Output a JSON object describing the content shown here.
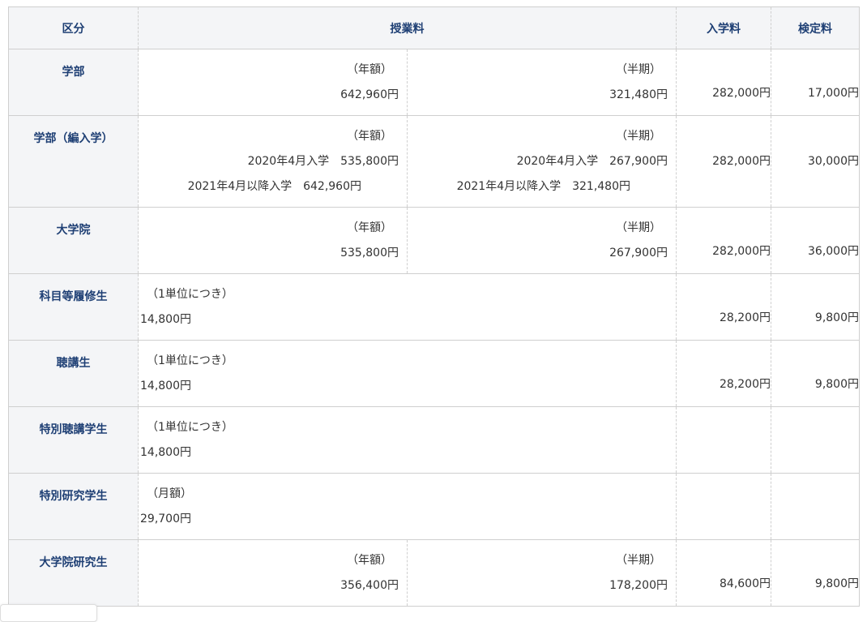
{
  "header": {
    "category": "区分",
    "tuition": "授業料",
    "admission": "入学料",
    "exam": "検定料"
  },
  "rows": [
    {
      "category": "学部",
      "annual_label": "（年額）",
      "annual": "642,960円",
      "half_label": "（半期）",
      "half": "321,480円",
      "admission": "282,000円",
      "exam": "17,000円"
    },
    {
      "category": "学部（編入学）",
      "annual_label": "（年額）",
      "annual_2020": "2020年4月入学　535,800円",
      "annual_2021": "2021年4月以降入学　642,960円",
      "half_label": "（半期）",
      "half_2020": "2020年4月入学　267,900円",
      "half_2021": "2021年4月以降入学　321,480円",
      "admission": "282,000円",
      "exam": "30,000円"
    },
    {
      "category": "大学院",
      "annual_label": "（年額）",
      "annual": "535,800円",
      "half_label": "（半期）",
      "half": "267,900円",
      "admission": "282,000円",
      "exam": "36,000円"
    },
    {
      "category": "科目等履修生",
      "unit_label": "（1単位につき）",
      "unit": "14,800円",
      "admission": "28,200円",
      "exam": "9,800円"
    },
    {
      "category": "聴講生",
      "unit_label": "（1単位につき）",
      "unit": "14,800円",
      "admission": "28,200円",
      "exam": "9,800円"
    },
    {
      "category": "特別聴講学生",
      "unit_label": "（1単位につき）",
      "unit": "14,800円",
      "admission": "",
      "exam": ""
    },
    {
      "category": "特別研究学生",
      "unit_label": "（月額）",
      "unit": "29,700円",
      "admission": "",
      "exam": ""
    },
    {
      "category": "大学院研究生",
      "annual_label": "（年額）",
      "annual": "356,400円",
      "half_label": "（半期）",
      "half": "178,200円",
      "admission": "84,600円",
      "exam": "9,800円"
    }
  ],
  "colors": {
    "header_bg": "#f4f5f7",
    "header_text": "#1e3f74",
    "border": "#cfcfcf",
    "text": "#333333"
  }
}
